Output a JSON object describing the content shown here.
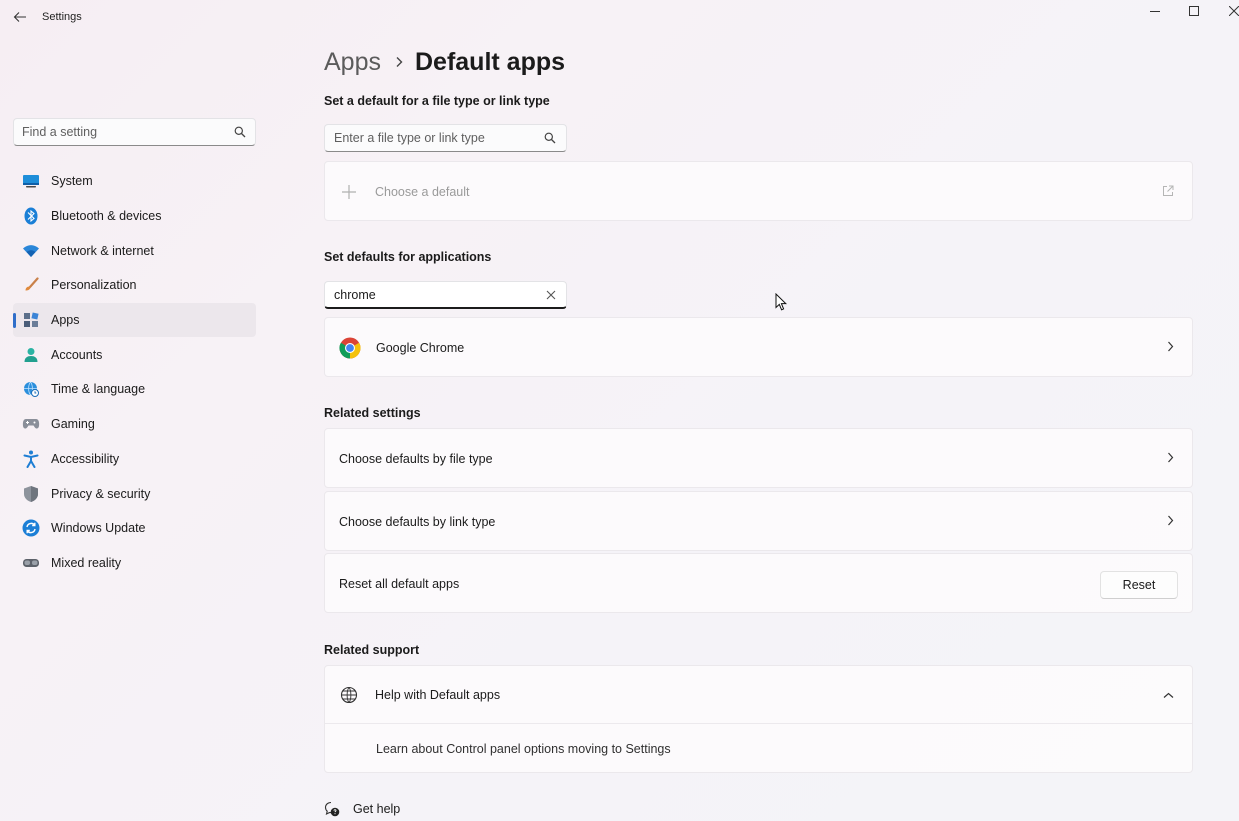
{
  "window": {
    "title": "Settings",
    "back_icon": "back-arrow-icon",
    "controls": [
      "minimize-icon",
      "maximize-icon",
      "close-icon"
    ]
  },
  "sidebar": {
    "search_placeholder": "Find a setting",
    "items": [
      {
        "label": "System",
        "icon": "system-icon"
      },
      {
        "label": "Bluetooth & devices",
        "icon": "bluetooth-icon"
      },
      {
        "label": "Network & internet",
        "icon": "wifi-icon"
      },
      {
        "label": "Personalization",
        "icon": "brush-icon"
      },
      {
        "label": "Apps",
        "icon": "apps-icon",
        "active": true
      },
      {
        "label": "Accounts",
        "icon": "account-icon"
      },
      {
        "label": "Time & language",
        "icon": "globe-clock-icon"
      },
      {
        "label": "Gaming",
        "icon": "controller-icon"
      },
      {
        "label": "Accessibility",
        "icon": "accessibility-icon"
      },
      {
        "label": "Privacy & security",
        "icon": "shield-icon"
      },
      {
        "label": "Windows Update",
        "icon": "update-icon"
      },
      {
        "label": "Mixed reality",
        "icon": "headset-icon"
      }
    ]
  },
  "breadcrumb": {
    "parent": "Apps",
    "current": "Default apps"
  },
  "file_type_section": {
    "heading": "Set a default for a file type or link type",
    "search_placeholder": "Enter a file type or link type",
    "choose_default_label": "Choose a default"
  },
  "apps_section": {
    "heading": "Set defaults for applications",
    "search_value": "chrome",
    "results": [
      {
        "label": "Google Chrome",
        "icon": "chrome-icon"
      }
    ]
  },
  "related_settings": {
    "heading": "Related settings",
    "by_file_type": "Choose defaults by file type",
    "by_link_type": "Choose defaults by link type",
    "reset_label": "Reset all default apps",
    "reset_button": "Reset"
  },
  "related_support": {
    "heading": "Related support",
    "help_title": "Help with Default apps",
    "help_link": "Learn about Control panel options moving to Settings"
  },
  "footer": {
    "get_help": "Get help"
  },
  "colors": {
    "accent": "#2f6ec9"
  }
}
